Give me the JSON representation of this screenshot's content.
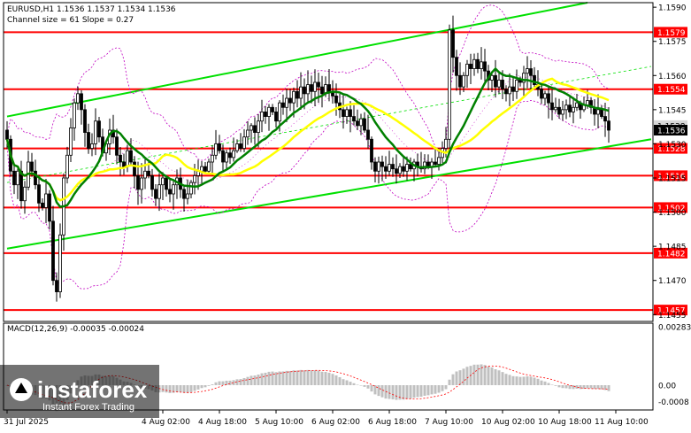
{
  "header": {
    "symbol_line": "EURUSD,H1  1.1536 1.1537 1.1534 1.1536",
    "channel_line": "Channel size = 61 Slope = 0.27"
  },
  "macd_label": "MACD(12,26,9) -0.00035 -0.00024",
  "watermark": {
    "brand": "instaforex",
    "tagline": "Instant Forex Trading"
  },
  "colors": {
    "background": "#ffffff",
    "level_line": "#ff0000",
    "channel_line": "#00e000",
    "ma_green": "#008000",
    "ma_yellow": "#ffff00",
    "bollinger": "#c000c0",
    "candles": "#000000",
    "current_price_box": "#000000",
    "macd_hist": "#c0c0c0",
    "macd_signal": "#ff0000"
  },
  "chart_data": {
    "type": "candlestick",
    "symbol": "EURUSD",
    "timeframe": "H1",
    "price_axis": {
      "ylim": [
        1.1452,
        1.1592
      ],
      "ticks": [
        "1.1590",
        "1.1575",
        "1.1560",
        "1.1545",
        "1.1530",
        "1.1515",
        "1.1500",
        "1.1485",
        "1.1470",
        "1.1455"
      ]
    },
    "time_axis": {
      "labels": [
        "31 Jul 2025",
        "4 Aug 02:00",
        "4 Aug 18:00",
        "5 Aug 10:00",
        "6 Aug 02:00",
        "6 Aug 18:00",
        "7 Aug 10:00",
        "10 Aug 02:00",
        "10 Aug 18:00",
        "11 Aug 10:00"
      ],
      "label_index": [
        0,
        44,
        60,
        76,
        92,
        108,
        124,
        140,
        156,
        172
      ]
    },
    "current_price": "1.1536",
    "secondary_price_label": "1.1538",
    "levels": [
      {
        "price": 1.1579,
        "label": "1.1579"
      },
      {
        "price": 1.1554,
        "label": "1.1554"
      },
      {
        "price": 1.1528,
        "label": "1.1528"
      },
      {
        "price": 1.1516,
        "label": "1.1516"
      },
      {
        "price": 1.1502,
        "label": "1.1502"
      },
      {
        "price": 1.1482,
        "label": "1.1482"
      },
      {
        "price": 1.1457,
        "label": "1.1457"
      }
    ],
    "channel": {
      "upper": {
        "start": [
          0,
          1.1542
        ],
        "end": [
          164,
          1.1592
        ]
      },
      "lower": {
        "start": [
          0,
          1.1484
        ],
        "end": [
          182,
          1.1532
        ]
      },
      "middle": {
        "start": [
          0,
          1.1513
        ],
        "end": [
          182,
          1.1564
        ]
      }
    },
    "closes": [
      1.1532,
      1.1518,
      1.1512,
      1.1518,
      1.1505,
      1.1511,
      1.1522,
      1.1518,
      1.1512,
      1.1504,
      1.1502,
      1.1508,
      1.1496,
      1.147,
      1.1465,
      1.149,
      1.1515,
      1.1525,
      1.1537,
      1.1548,
      1.1552,
      1.1545,
      1.1535,
      1.1528,
      1.153,
      1.154,
      1.1533,
      1.1526,
      1.153,
      1.1536,
      1.1533,
      1.1525,
      1.1522,
      1.152,
      1.1527,
      1.1522,
      1.1516,
      1.151,
      1.1515,
      1.1518,
      1.1516,
      1.151,
      1.1506,
      1.1512,
      1.1515,
      1.151,
      1.1508,
      1.1512,
      1.1515,
      1.151,
      1.1506,
      1.1508,
      1.1513,
      1.1516,
      1.1518,
      1.152,
      1.1518,
      1.1522,
      1.1525,
      1.153,
      1.1527,
      1.1522,
      1.1526,
      1.1524,
      1.1527,
      1.153,
      1.1528,
      1.1533,
      1.1536,
      1.1538,
      1.1535,
      1.154,
      1.1544,
      1.1542,
      1.1546,
      1.1544,
      1.154,
      1.1548,
      1.1546,
      1.155,
      1.1548,
      1.1553,
      1.155,
      1.1555,
      1.1552,
      1.1556,
      1.1553,
      1.1557,
      1.1555,
      1.1552,
      1.1556,
      1.1553,
      1.1551,
      1.1548,
      1.1545,
      1.1542,
      1.1545,
      1.1542,
      1.154,
      1.1538,
      1.1541,
      1.1536,
      1.1532,
      1.1522,
      1.1518,
      1.1522,
      1.152,
      1.1518,
      1.1521,
      1.1519,
      1.1517,
      1.152,
      1.1518,
      1.1521,
      1.1519,
      1.1522,
      1.152,
      1.1519,
      1.1522,
      1.152,
      1.1522,
      1.1521,
      1.1524,
      1.1528,
      1.1532,
      1.158,
      1.1568,
      1.156,
      1.1555,
      1.156,
      1.1565,
      1.1563,
      1.1567,
      1.1563,
      1.1566,
      1.1562,
      1.1558,
      1.156,
      1.1555,
      1.1558,
      1.1554,
      1.1552,
      1.1555,
      1.1553,
      1.1558,
      1.1557,
      1.1561,
      1.1563,
      1.156,
      1.1556,
      1.1554,
      1.155,
      1.1552,
      1.1548,
      1.1545,
      1.1546,
      1.1543,
      1.1545,
      1.1547,
      1.1544,
      1.1546,
      1.1548,
      1.1545,
      1.1547,
      1.1549,
      1.1546,
      1.1543,
      1.1545,
      1.1542,
      1.154,
      1.1536
    ],
    "macd": {
      "label": "MACD(12,26,9) -0.00035 -0.00024",
      "ylim": [
        -0.0012,
        0.003
      ],
      "ticks": [
        "0.00283",
        "0.00",
        "-0.0008"
      ]
    }
  }
}
